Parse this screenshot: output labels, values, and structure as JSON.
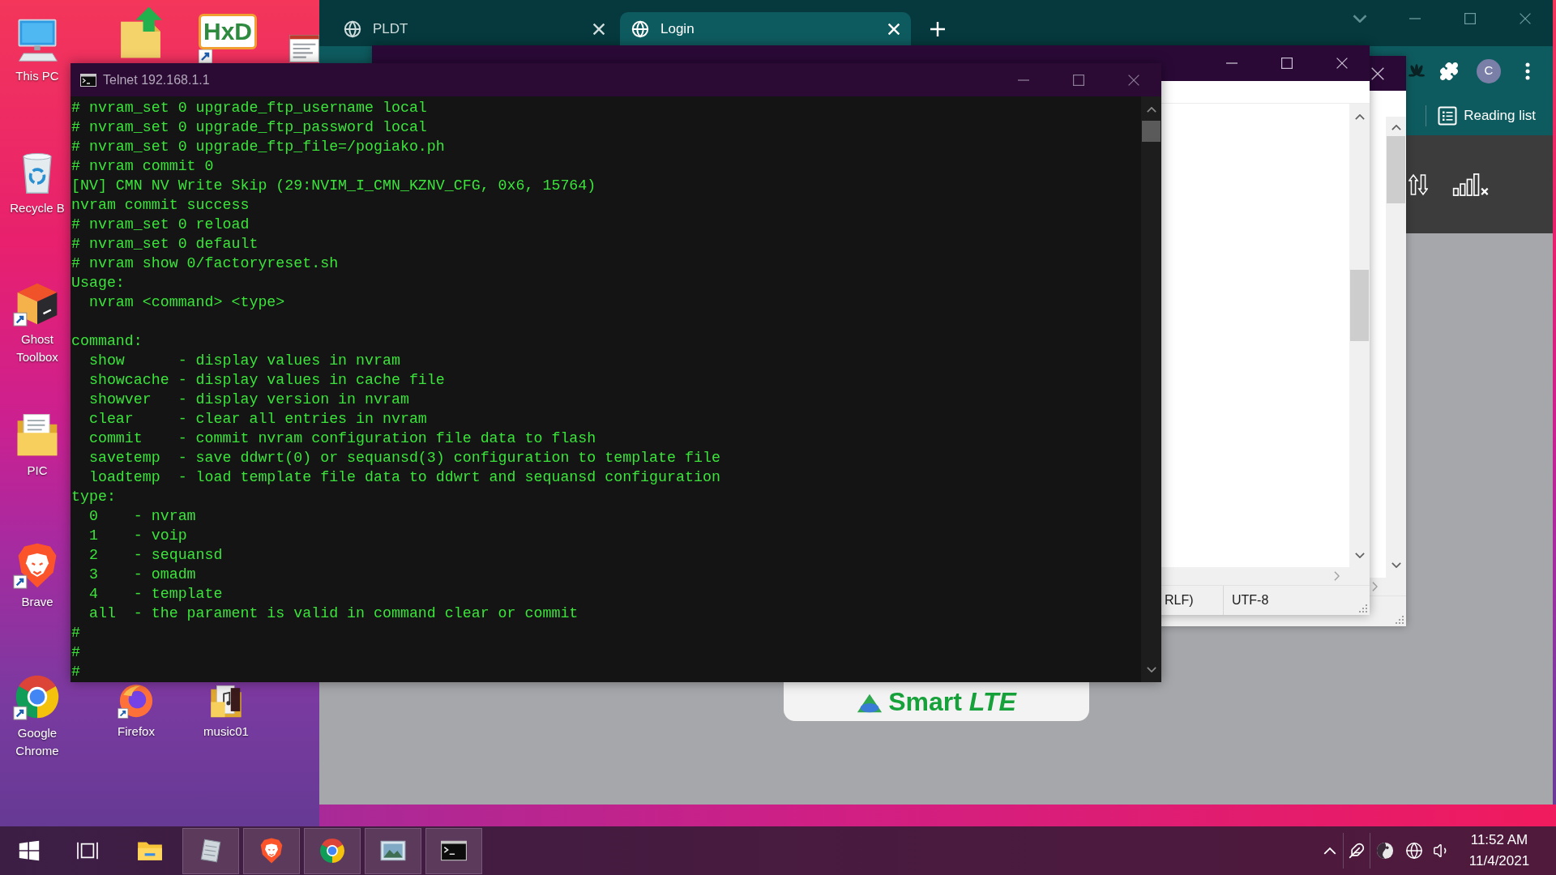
{
  "desktop": {
    "top_icons": [
      {
        "kind": "upload-folder",
        "shortcut": false
      },
      {
        "kind": "hex-editor",
        "logo_text": "HxD",
        "shortcut": true
      },
      {
        "kind": "screenshot",
        "shortcut": false
      }
    ],
    "icons": [
      {
        "kind": "computer",
        "label": "This PC",
        "shortcut": false
      },
      {
        "kind": "recycle-bin",
        "label": "Recycle B",
        "shortcut": false
      },
      {
        "kind": "toolbox",
        "label": "Ghost Toolbox",
        "shortcut": true
      },
      {
        "kind": "document-folder",
        "label": "PIC",
        "shortcut": false
      },
      {
        "kind": "brave",
        "label": "Brave",
        "shortcut": true
      },
      {
        "kind": "chrome",
        "label": "Google Chrome",
        "shortcut": true
      },
      {
        "kind": "firefox",
        "label": "Firefox",
        "shortcut": true
      },
      {
        "kind": "music-folder",
        "label": "music01",
        "shortcut": false
      }
    ]
  },
  "browser": {
    "tabs": [
      {
        "title": "PLDT",
        "selected": false
      },
      {
        "title": "Login",
        "selected": true
      }
    ],
    "profile_initial": "C",
    "bookmarks_bar": {
      "reading_list": "Reading list"
    },
    "page": {
      "logo_text": "Smart *LTE*"
    }
  },
  "notepad": {
    "status_bar": [
      "RLF)",
      "UTF-8"
    ]
  },
  "telnet": {
    "title": "Telnet 192.168.1.1",
    "blocks": [
      [
        "# nvram_set 0 upgrade_ftp_username local",
        "# nvram_set 0 upgrade_ftp_password local",
        "# nvram_set 0 upgrade_ftp_file=/pogiako.ph",
        "# nvram commit 0",
        "[NV] CMN NV Write Skip (29:NVIM_I_CMN_KZNV_CFG, 0x6, 15764)",
        "nvram commit success",
        "# nvram_set 0 reload",
        "# nvram_set 0 default",
        "# nvram show 0/factoryreset.sh",
        "Usage:",
        "  nvram <command> <type>"
      ],
      [
        "command:",
        "  show      - display values in nvram",
        "  showcache - display values in cache file",
        "  showver   - display version in nvram",
        "  clear     - clear all entries in nvram",
        "  commit    - commit nvram configuration file data to flash",
        "  savetemp  - save ddwrt(0) or sequansd(3) configuration to template file",
        "  loadtemp  - load template file data to ddwrt and sequansd configuration",
        "type:",
        "  0    - nvram",
        "  1    - voip",
        "  2    - sequansd",
        "  3    - omadm",
        "  4    - template",
        "  all  - the parament is valid in command clear or commit",
        "#",
        "#",
        "#"
      ]
    ]
  },
  "taskbar": {
    "apps": [
      {
        "kind": "file-explorer",
        "running": false
      },
      {
        "kind": "notepad",
        "running": true
      },
      {
        "kind": "brave",
        "running": true
      },
      {
        "kind": "chrome",
        "running": true
      },
      {
        "kind": "photos",
        "running": true
      },
      {
        "kind": "terminal",
        "running": true
      }
    ],
    "clock": {
      "time": "11:52 AM",
      "date": "11/4/2021"
    }
  }
}
